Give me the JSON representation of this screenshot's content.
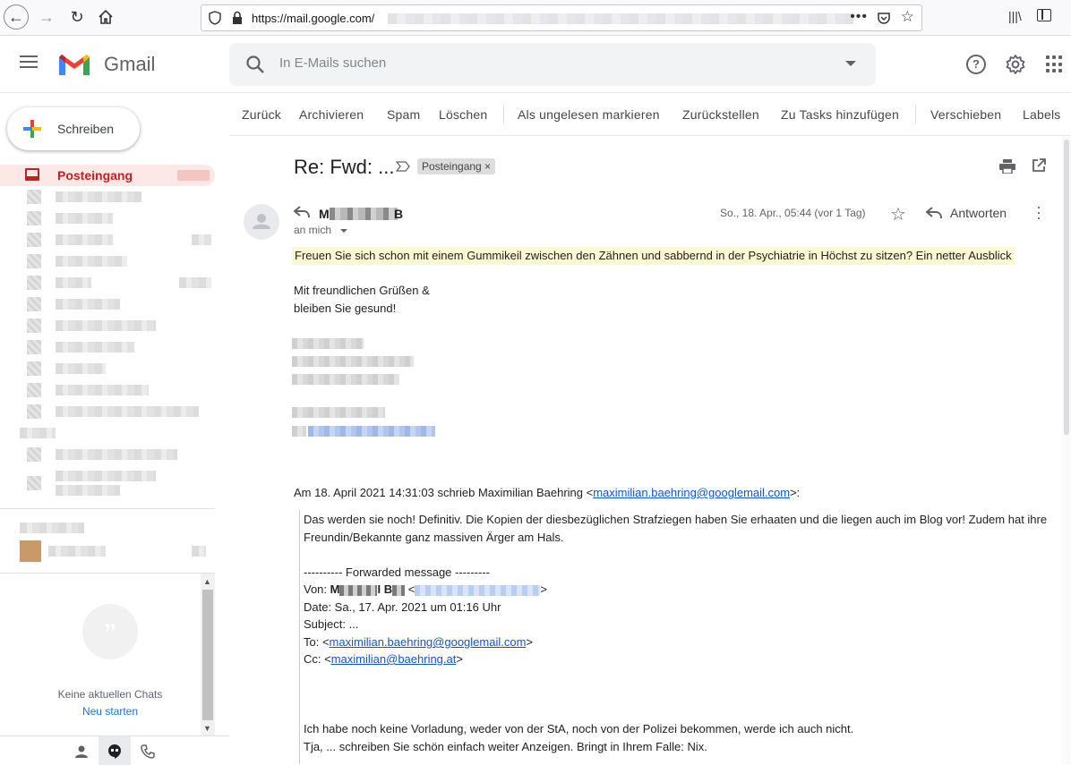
{
  "browser": {
    "url_prefix": "https://mail.google.com/"
  },
  "header": {
    "app_name": "Gmail",
    "search_placeholder": "In E-Mails suchen"
  },
  "sidebar": {
    "compose_label": "Schreiben",
    "inbox_label": "Posteingang"
  },
  "chat": {
    "no_chats": "Keine aktuellen Chats",
    "start_new": "Neu starten"
  },
  "toolbar": {
    "items": [
      "Zurück",
      "Archivieren",
      "Spam",
      "Löschen",
      "Als ungelesen markieren",
      "Zurückstellen",
      "Zu Tasks hinzufügen",
      "Verschieben",
      "Labels"
    ]
  },
  "email": {
    "subject": "Re: Fwd: ...",
    "label_chip": "Posteingang ×",
    "sender_initial": "M",
    "sender_mid": "B",
    "recipient": "an mich",
    "date": "So., 18. Apr., 05:44 (vor 1 Tag)",
    "reply_label": "Antworten",
    "highlight": "Freuen Sie sich schon mit einem Gummikeil zwischen den Zähnen und sabbernd in der Psychiatrie in Höchst zu sitzen? Ein netter Ausblick",
    "greeting_1": "Mit freundlichen Grüßen &",
    "greeting_2": "bleiben Sie gesund!",
    "quote_intro": "Am 18. April 2021 14:31:03 schrieb Maximilian Baehring <",
    "quote_intro_email": "maximilian.baehring@googlemail.com",
    "quote_intro_end": ">:",
    "quoted": {
      "line1": "Das werden sie noch! Definitiv. Die Kopien der diesbezüglichen Strafziegen haben Sie erhaaten und die liegen auch im Blog vor! Zudem hat ihre",
      "line2": "Freundin/Bekannte ganz massiven Ärger am Hals.",
      "fwd": "---------- Forwarded message ---------",
      "von_label": "Von: ",
      "von_initial": "M",
      "von_mid": "I B",
      "date": "Date: Sa., 17. Apr. 2021 um 01:16 Uhr",
      "subject": "Subject: ...",
      "to_label": "To: <",
      "to_email": "maximilian.baehring@googlemail.com",
      "cc_label": "Cc: <",
      "cc_email": "maximilian@baehring.at",
      "close": ">",
      "line_a": "Ich habe noch keine Vorladung, weder von der StA, noch von der Polizei bekommen, werde ich auch nicht.",
      "line_b": "Tja, ... schreiben Sie schön einfach weiter Anzeigen. Bringt in Ihrem Falle: Nix."
    }
  }
}
